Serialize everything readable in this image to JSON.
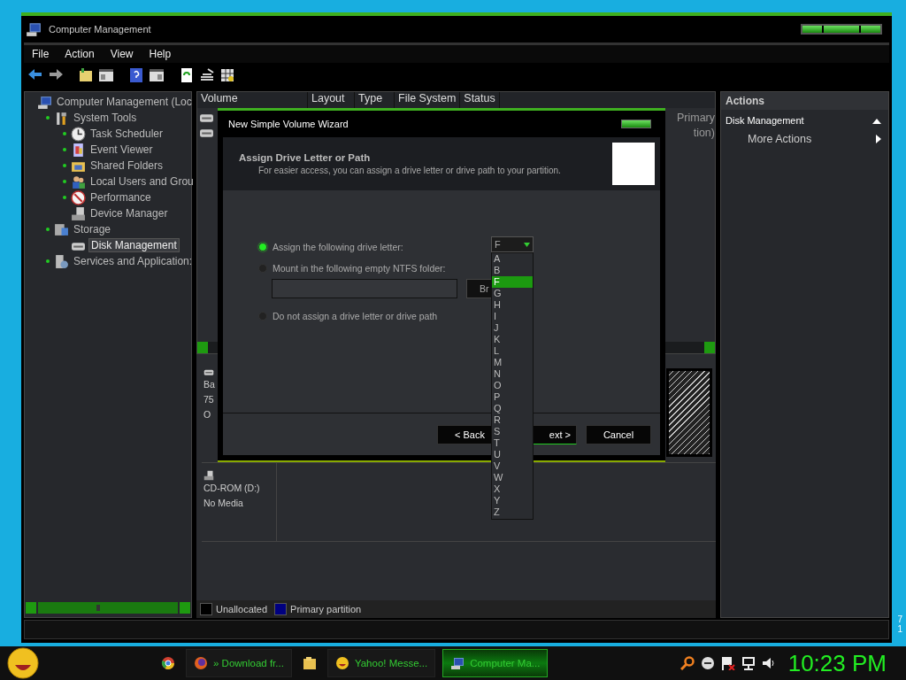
{
  "window": {
    "title": "Computer Management",
    "menu": [
      "File",
      "Action",
      "View",
      "Help"
    ]
  },
  "tree": {
    "label": "Computer Management (Loc",
    "expander": false,
    "selected": false,
    "children": [
      {
        "label": "System Tools",
        "expander": true,
        "selected": false,
        "children": [
          {
            "label": "Task Scheduler",
            "expander": true,
            "selected": false
          },
          {
            "label": "Event Viewer",
            "expander": true,
            "selected": false
          },
          {
            "label": "Shared Folders",
            "expander": true,
            "selected": false
          },
          {
            "label": "Local Users and Grou",
            "expander": true,
            "selected": false
          },
          {
            "label": "Performance",
            "expander": true,
            "selected": false
          },
          {
            "label": "Device Manager",
            "expander": false,
            "selected": false
          }
        ]
      },
      {
        "label": "Storage",
        "expander": true,
        "selected": false,
        "children": [
          {
            "label": "Disk Management",
            "expander": false,
            "selected": true
          }
        ]
      },
      {
        "label": "Services and Application:",
        "expander": true,
        "selected": false
      }
    ]
  },
  "volume_table": {
    "columns": [
      "Volume",
      "Layout",
      "Type",
      "File System",
      "Status"
    ],
    "rows": [
      {
        "column_5": "Primary"
      },
      {
        "column_5": "tion)"
      }
    ]
  },
  "disks": [
    {
      "lines": [
        "Ba",
        "75",
        "O"
      ],
      "kind": "disk"
    },
    {
      "lines": [
        "CD-ROM (D:)",
        "No Media"
      ],
      "kind": "cdrom"
    }
  ],
  "legend": [
    {
      "label": "Unallocated",
      "color": "#000000"
    },
    {
      "label": "Primary partition",
      "color": "#000080"
    }
  ],
  "actions": {
    "title": "Actions",
    "section": "Disk Management",
    "items": [
      "More Actions"
    ]
  },
  "wizard": {
    "title": "New Simple Volume Wizard",
    "heading": "Assign Drive Letter or Path",
    "subtitle": "For easier access, you can assign a drive letter or drive path to your partition.",
    "options": [
      {
        "label": "Assign the following drive letter:",
        "selected": true
      },
      {
        "label": "Mount in the following empty NTFS folder:",
        "selected": false
      },
      {
        "label": "Do not assign a drive letter or drive path",
        "selected": false
      }
    ],
    "browse_button": "Br",
    "buttons": [
      "< Back",
      "ext >",
      "Cancel"
    ],
    "drive_letter": {
      "value": "F",
      "options": [
        {
          "label": "A",
          "selected": false
        },
        {
          "label": "B",
          "selected": false
        },
        {
          "label": "F",
          "selected": true
        },
        {
          "label": "G",
          "selected": false
        },
        {
          "label": "H",
          "selected": false
        },
        {
          "label": "I",
          "selected": false
        },
        {
          "label": "J",
          "selected": false
        },
        {
          "label": "K",
          "selected": false
        },
        {
          "label": "L",
          "selected": false
        },
        {
          "label": "M",
          "selected": false
        },
        {
          "label": "N",
          "selected": false
        },
        {
          "label": "O",
          "selected": false
        },
        {
          "label": "P",
          "selected": false
        },
        {
          "label": "Q",
          "selected": false
        },
        {
          "label": "R",
          "selected": false
        },
        {
          "label": "S",
          "selected": false
        },
        {
          "label": "T",
          "selected": false
        },
        {
          "label": "U",
          "selected": false
        },
        {
          "label": "V",
          "selected": false
        },
        {
          "label": "W",
          "selected": false
        },
        {
          "label": "X",
          "selected": false
        },
        {
          "label": "Y",
          "selected": false
        },
        {
          "label": "Z",
          "selected": false
        }
      ]
    }
  },
  "edge_text": [
    "7",
    "1"
  ],
  "taskbar": {
    "items": [
      {
        "kind": "icon"
      },
      {
        "kind": "task",
        "label": "» Download fr...",
        "selected": false
      },
      {
        "kind": "icon"
      },
      {
        "kind": "task",
        "label": "Yahoo! Messe...",
        "selected": false
      },
      {
        "kind": "task",
        "label": "Computer Ma...",
        "selected": true
      }
    ],
    "clock": "10:23 PM"
  }
}
